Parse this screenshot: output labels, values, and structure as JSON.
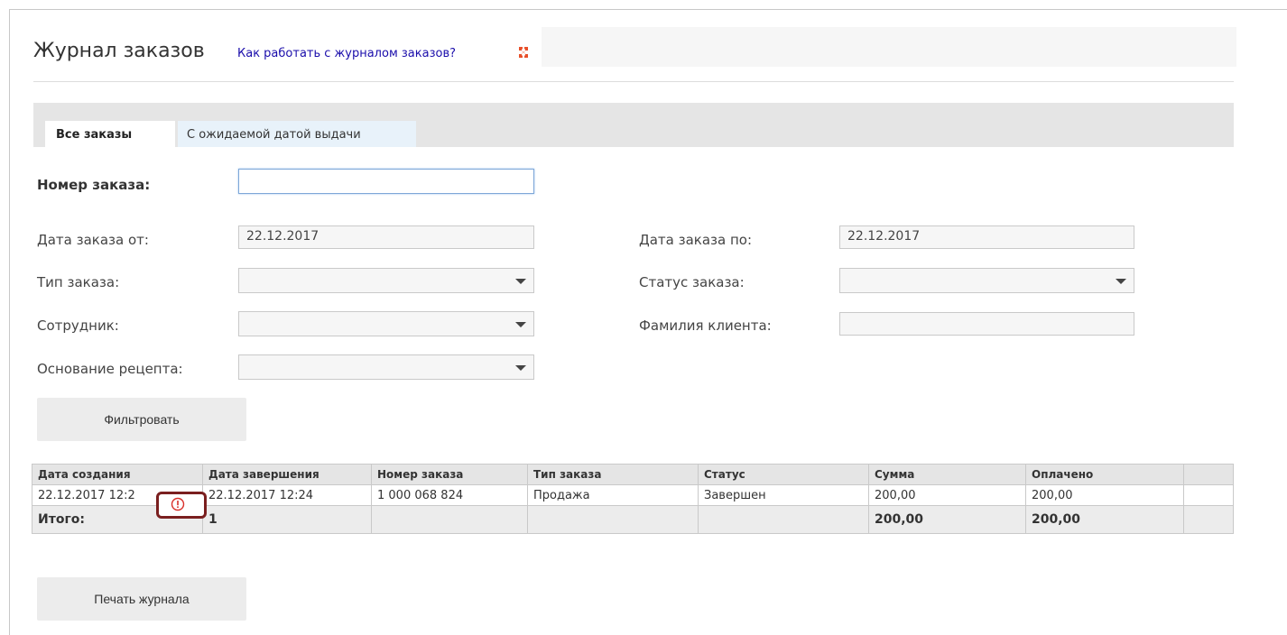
{
  "page": {
    "title": "Журнал заказов",
    "help_link": "Как работать с журналом заказов?"
  },
  "tabs": [
    {
      "label": "Все заказы",
      "active": true
    },
    {
      "label": "С ожидаемой датой выдачи",
      "active": false
    }
  ],
  "filters": {
    "order_number": {
      "label": "Номер заказа:",
      "value": ""
    },
    "date_from": {
      "label": "Дата заказа от:",
      "value": "22.12.2017"
    },
    "date_to": {
      "label": "Дата заказа по:",
      "value": "22.12.2017"
    },
    "order_type": {
      "label": "Тип заказа:",
      "value": ""
    },
    "order_status": {
      "label": "Статус заказа:",
      "value": ""
    },
    "employee": {
      "label": "Сотрудник:",
      "value": ""
    },
    "client_surname": {
      "label": "Фамилия клиента:",
      "value": ""
    },
    "prescription_basis": {
      "label": "Основание рецепта:",
      "value": ""
    },
    "filter_button": "Фильтровать"
  },
  "table": {
    "headers": [
      "Дата создания",
      "Дата завершения",
      "Номер заказа",
      "Тип заказа",
      "Статус",
      "Сумма",
      "Оплачено",
      ""
    ],
    "rows": [
      [
        "22.12.2017 12:2",
        "22.12.2017 12:24",
        "1 000 068 824",
        "Продажа",
        "Завершен",
        "200,00",
        "200,00",
        ""
      ]
    ],
    "total": [
      "Итого:",
      "1",
      "",
      "",
      "",
      "200,00",
      "200,00",
      ""
    ]
  },
  "print_button": "Печать журнала",
  "icons": {
    "help": "help-puzzle-icon",
    "warning": "warning-exclamation-icon"
  },
  "colors": {
    "help_icon": "#e8502a",
    "warning_icon": "#d9302a",
    "highlight_border": "#7a1f1f",
    "link": "#1a0dab"
  }
}
